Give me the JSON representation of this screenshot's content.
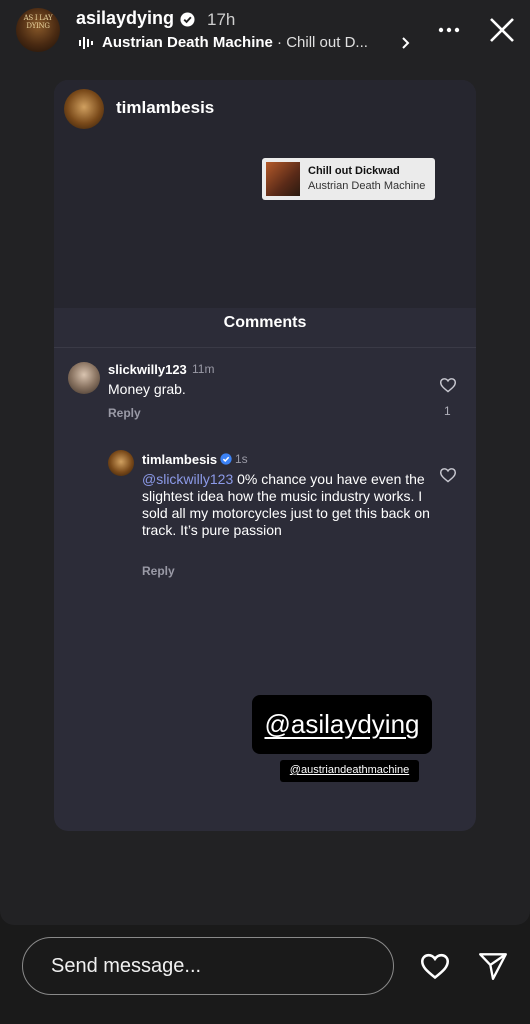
{
  "header": {
    "avatar_text": "AS I LAY DYING",
    "username": "asilaydying",
    "time": "17h",
    "song_title": "Austrian Death Machine",
    "song_sub": "· Chill out D..."
  },
  "card": {
    "username": "timlambesis",
    "music_chip": {
      "title": "Chill out Dickwad",
      "artist": "Austrian Death Machine"
    },
    "comments_title": "Comments",
    "comments": [
      {
        "user": "slickwilly123",
        "time": "11m",
        "text": "Money grab.",
        "reply": "Reply",
        "likes": "1"
      },
      {
        "user": "timlambesis",
        "time": "1s",
        "mention": "@slickwilly123",
        "text": " 0% chance you have even the slightest idea how the music industry works. I sold all my motorcycles just to get this back on track. It’s pure passion",
        "reply": "Reply"
      }
    ]
  },
  "stickers": {
    "primary": "@asilaydying",
    "secondary": "@austriandeathmachine"
  },
  "footer": {
    "placeholder": "Send message..."
  }
}
